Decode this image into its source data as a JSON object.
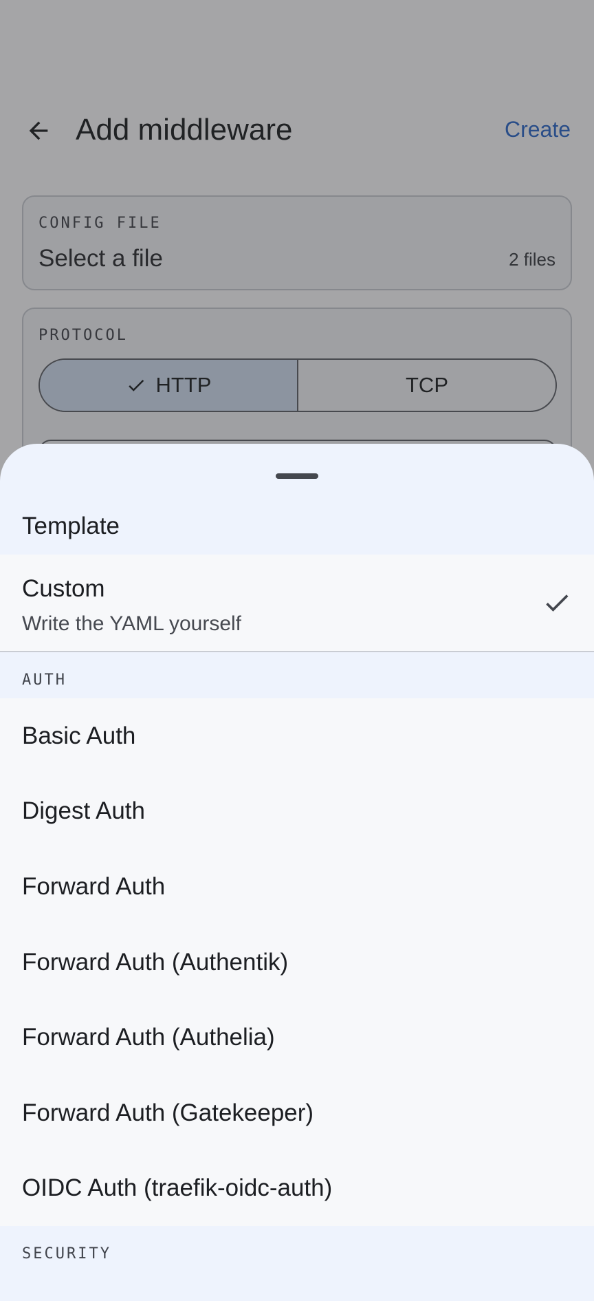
{
  "header": {
    "back_icon": "arrow-left-icon",
    "title": "Add middleware",
    "create_label": "Create"
  },
  "config_file": {
    "caption": "CONFIG FILE",
    "value": "Select a file",
    "count": "2 files"
  },
  "protocol": {
    "caption": "PROTOCOL",
    "options": [
      {
        "label": "HTTP",
        "selected": true
      },
      {
        "label": "TCP",
        "selected": false
      }
    ]
  },
  "sheet": {
    "title": "Template",
    "custom": {
      "title": "Custom",
      "subtitle": "Write the YAML yourself",
      "selected": true
    },
    "sections": [
      {
        "label": "AUTH",
        "items": [
          "Basic Auth",
          "Digest Auth",
          "Forward Auth",
          "Forward Auth (Authentik)",
          "Forward Auth (Authelia)",
          "Forward Auth (Gatekeeper)",
          "OIDC Auth (traefik-oidc-auth)"
        ]
      },
      {
        "label": "SECURITY",
        "items": []
      }
    ]
  },
  "colors": {
    "accent": "#2a66c9",
    "sheet_background": "#eef3fd",
    "selected_segment": "#cfddf0"
  }
}
